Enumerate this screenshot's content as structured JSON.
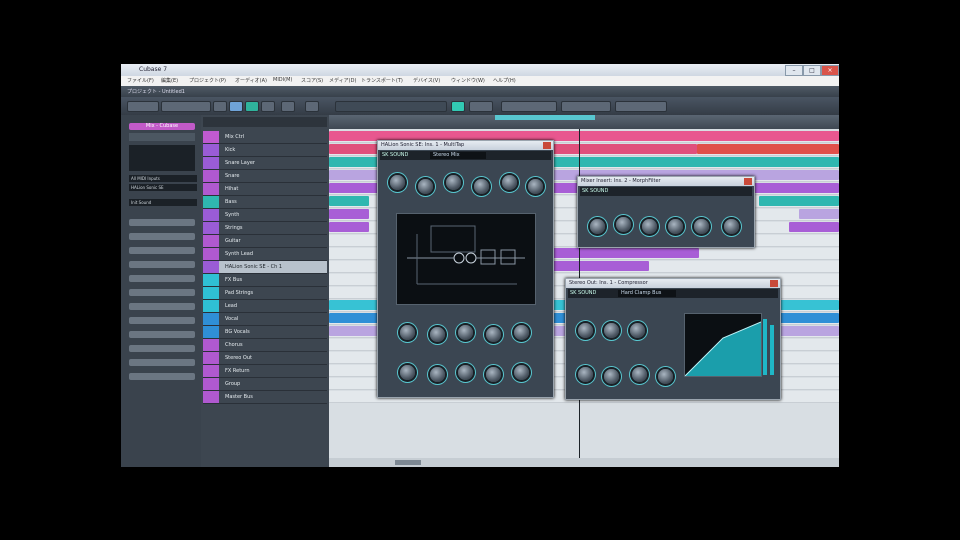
{
  "colors": {
    "accent": "#58c7d0",
    "part_pink": "#e8578f",
    "part_red": "#e0504a",
    "part_teal": "#2fb7b0",
    "part_purple": "#a85ed6",
    "part_lavender": "#b9a4e0",
    "part_cyan": "#37c2d4",
    "track_purple": "#9a5cd6",
    "track_blue": "#2f8fd6",
    "track_yellow": "#e0d040"
  },
  "window": {
    "title": "Cubase 7",
    "btn_min": "–",
    "btn_max": "□",
    "btn_close": "×"
  },
  "menu": {
    "items": [
      "ファイル(F)",
      "編集(E)",
      "プロジェクト(P)",
      "オーディオ(A)",
      "MIDI(M)",
      "スコア(S)",
      "メディア(D)",
      "トランスポート(T)",
      "デバイス(V)",
      "ウィンドウ(W)",
      "ヘルプ(H)"
    ]
  },
  "project": {
    "title": "プロジェクト - Untitled1"
  },
  "inspector": {
    "track_name": "Mix - Cubase",
    "route_in": "All MIDI Inputs",
    "route_out": "HALion Sonic SE",
    "preset": "Init Sound"
  },
  "tracks": [
    {
      "name": "Mix Ctrl"
    },
    {
      "name": "Kick"
    },
    {
      "name": "Snare Layer"
    },
    {
      "name": "Snare"
    },
    {
      "name": "Hihat"
    },
    {
      "name": "Bass"
    },
    {
      "name": "Synth"
    },
    {
      "name": "Strings"
    },
    {
      "name": "Guitar"
    },
    {
      "name": "Synth Lead"
    },
    {
      "name": "HALion Sonic SE - Ch 1"
    },
    {
      "name": "FX Bus"
    },
    {
      "name": "Pad Strings"
    },
    {
      "name": "Lead"
    },
    {
      "name": "Vocal"
    },
    {
      "name": "BG Vocals"
    },
    {
      "name": "Chorus"
    },
    {
      "name": "Stereo Out"
    },
    {
      "name": "FX Return"
    },
    {
      "name": "Group"
    },
    {
      "name": "Master Bus"
    }
  ],
  "plugins": {
    "p1": {
      "title": "HALion Sonic SE: Ins. 1 - MultiTap",
      "brand": "SK SOUND",
      "preset": "Stereo Mix"
    },
    "p2": {
      "title": "Mixer Insert: Ins. 2 - MorphFilter",
      "brand": "SK SOUND"
    },
    "p3": {
      "title": "Stereo Out: Ins. 1 - Compressor",
      "brand": "SK SOUND",
      "preset": "Hard Clamp Bus"
    }
  }
}
